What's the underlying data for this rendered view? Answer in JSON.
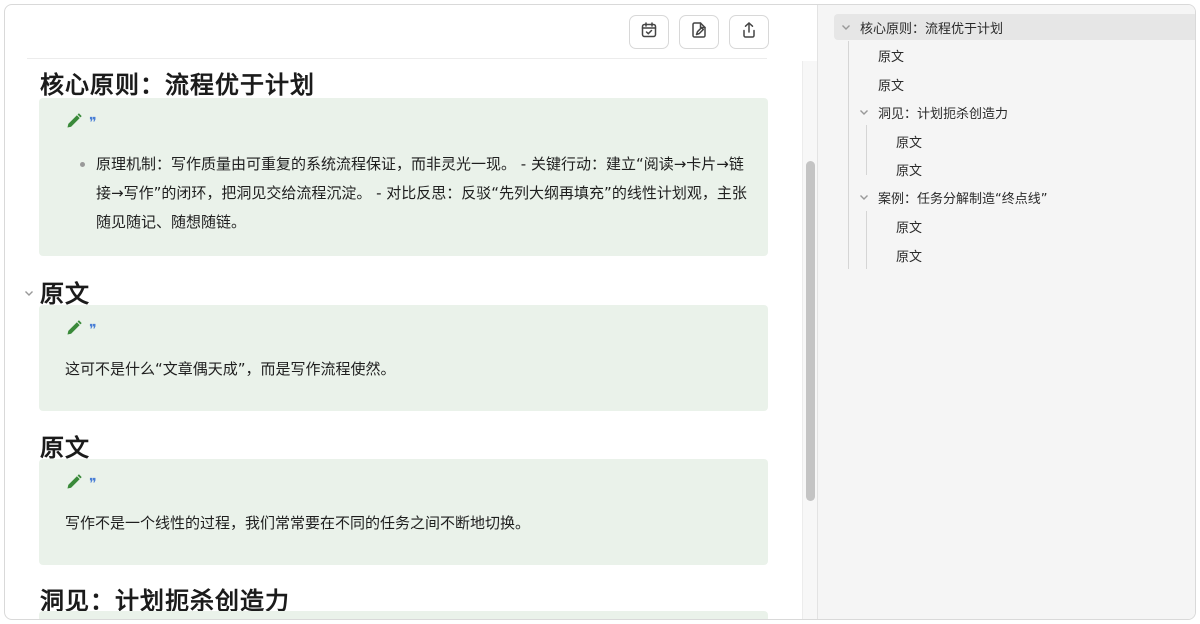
{
  "toolbar": {
    "buttons": [
      {
        "icon": "calendar-check-icon"
      },
      {
        "icon": "file-edit-icon"
      },
      {
        "icon": "share-icon"
      }
    ]
  },
  "document": {
    "sections": [
      {
        "heading": "核心原则：流程优于计划",
        "bullets": [
          "原理机制：写作质量由可重复的系统流程保证，而非灵光一现。 - 关键行动：建立“阅读→卡片→链接→写作”的闭环，把洞见交给流程沉淀。 - 对比反思：反驳“先列大纲再填充”的线性计划观，主张随见随记、随想随链。"
        ]
      },
      {
        "heading": "原文",
        "text": "这可不是什么“文章偶天成”，而是写作流程使然。"
      },
      {
        "heading": "原文",
        "text": "写作不是一个线性的过程，我们常常要在不同的任务之间不断地切换。"
      },
      {
        "heading": "洞见：计划扼杀创造力"
      }
    ]
  },
  "outline": {
    "items": [
      {
        "label": "核心原则：流程优于计划",
        "level": 0,
        "collapsible": true,
        "active": true
      },
      {
        "label": "原文",
        "level": 1,
        "collapsible": false
      },
      {
        "label": "原文",
        "level": 1,
        "collapsible": false
      },
      {
        "label": "洞见：计划扼杀创造力",
        "level": 1,
        "collapsible": true
      },
      {
        "label": "原文",
        "level": 2,
        "collapsible": false
      },
      {
        "label": "原文",
        "level": 2,
        "collapsible": false
      },
      {
        "label": "案例：任务分解制造“终点线”",
        "level": 1,
        "collapsible": true
      },
      {
        "label": "原文",
        "level": 2,
        "collapsible": false
      },
      {
        "label": "原文",
        "level": 2,
        "collapsible": false
      }
    ]
  },
  "colors": {
    "card_background": "#eaf2ea",
    "pencil_icon": "#3a8a3a",
    "quote_icon": "#4a7fd6"
  }
}
